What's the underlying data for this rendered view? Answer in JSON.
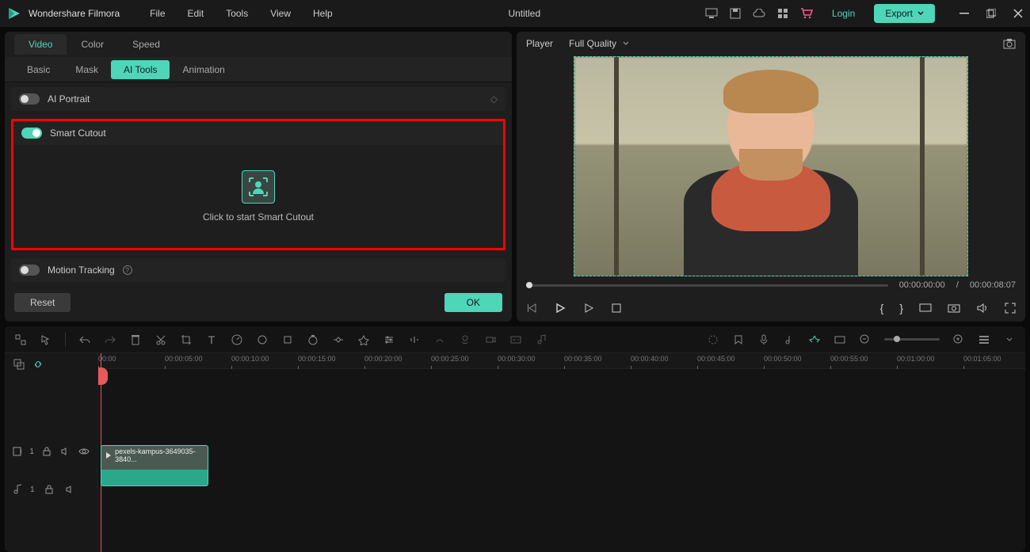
{
  "app": {
    "name": "Wondershare Filmora",
    "title": "Untitled"
  },
  "menu": [
    "File",
    "Edit",
    "Tools",
    "View",
    "Help"
  ],
  "titlebar": {
    "login": "Login",
    "export": "Export"
  },
  "props": {
    "tabs": [
      "Video",
      "Color",
      "Speed"
    ],
    "active_tab": 0,
    "subtabs": [
      "Basic",
      "Mask",
      "AI Tools",
      "Animation"
    ],
    "active_subtab": 2,
    "ai_portrait": {
      "label": "AI Portrait",
      "on": false
    },
    "smart_cutout": {
      "label": "Smart Cutout",
      "on": true,
      "help": "Click to start Smart Cutout"
    },
    "motion_tracking": {
      "label": "Motion Tracking",
      "on": false
    },
    "reset": "Reset",
    "ok": "OK"
  },
  "player": {
    "label": "Player",
    "quality": "Full Quality",
    "time_current": "00:00:00:00",
    "time_sep": "/",
    "time_total": "00:00:08:07",
    "curly_open": "{",
    "curly_close": "}"
  },
  "timeline": {
    "ruler": [
      "00:00",
      "00:00:05:00",
      "00:00:10:00",
      "00:00:15:00",
      "00:00:20:00",
      "00:00:25:00",
      "00:00:30:00",
      "00:00:35:00",
      "00:00:40:00",
      "00:00:45:00",
      "00:00:50:00",
      "00:00:55:00",
      "00:01:00:00",
      "00:01:05:00"
    ],
    "video_track_index": "1",
    "audio_track_index": "1",
    "clip_name": "pexels-kampus-3649035-3840..."
  }
}
